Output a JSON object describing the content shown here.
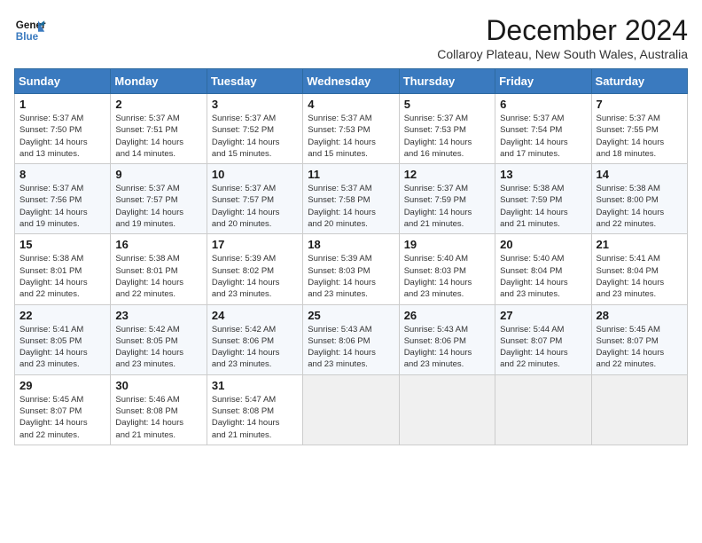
{
  "logo": {
    "line1": "General",
    "line2": "Blue"
  },
  "title": "December 2024",
  "subtitle": "Collaroy Plateau, New South Wales, Australia",
  "days_of_week": [
    "Sunday",
    "Monday",
    "Tuesday",
    "Wednesday",
    "Thursday",
    "Friday",
    "Saturday"
  ],
  "weeks": [
    [
      {
        "day": "1",
        "info": "Sunrise: 5:37 AM\nSunset: 7:50 PM\nDaylight: 14 hours\nand 13 minutes."
      },
      {
        "day": "2",
        "info": "Sunrise: 5:37 AM\nSunset: 7:51 PM\nDaylight: 14 hours\nand 14 minutes."
      },
      {
        "day": "3",
        "info": "Sunrise: 5:37 AM\nSunset: 7:52 PM\nDaylight: 14 hours\nand 15 minutes."
      },
      {
        "day": "4",
        "info": "Sunrise: 5:37 AM\nSunset: 7:53 PM\nDaylight: 14 hours\nand 15 minutes."
      },
      {
        "day": "5",
        "info": "Sunrise: 5:37 AM\nSunset: 7:53 PM\nDaylight: 14 hours\nand 16 minutes."
      },
      {
        "day": "6",
        "info": "Sunrise: 5:37 AM\nSunset: 7:54 PM\nDaylight: 14 hours\nand 17 minutes."
      },
      {
        "day": "7",
        "info": "Sunrise: 5:37 AM\nSunset: 7:55 PM\nDaylight: 14 hours\nand 18 minutes."
      }
    ],
    [
      {
        "day": "8",
        "info": "Sunrise: 5:37 AM\nSunset: 7:56 PM\nDaylight: 14 hours\nand 19 minutes."
      },
      {
        "day": "9",
        "info": "Sunrise: 5:37 AM\nSunset: 7:57 PM\nDaylight: 14 hours\nand 19 minutes."
      },
      {
        "day": "10",
        "info": "Sunrise: 5:37 AM\nSunset: 7:57 PM\nDaylight: 14 hours\nand 20 minutes."
      },
      {
        "day": "11",
        "info": "Sunrise: 5:37 AM\nSunset: 7:58 PM\nDaylight: 14 hours\nand 20 minutes."
      },
      {
        "day": "12",
        "info": "Sunrise: 5:37 AM\nSunset: 7:59 PM\nDaylight: 14 hours\nand 21 minutes."
      },
      {
        "day": "13",
        "info": "Sunrise: 5:38 AM\nSunset: 7:59 PM\nDaylight: 14 hours\nand 21 minutes."
      },
      {
        "day": "14",
        "info": "Sunrise: 5:38 AM\nSunset: 8:00 PM\nDaylight: 14 hours\nand 22 minutes."
      }
    ],
    [
      {
        "day": "15",
        "info": "Sunrise: 5:38 AM\nSunset: 8:01 PM\nDaylight: 14 hours\nand 22 minutes."
      },
      {
        "day": "16",
        "info": "Sunrise: 5:38 AM\nSunset: 8:01 PM\nDaylight: 14 hours\nand 22 minutes."
      },
      {
        "day": "17",
        "info": "Sunrise: 5:39 AM\nSunset: 8:02 PM\nDaylight: 14 hours\nand 23 minutes."
      },
      {
        "day": "18",
        "info": "Sunrise: 5:39 AM\nSunset: 8:03 PM\nDaylight: 14 hours\nand 23 minutes."
      },
      {
        "day": "19",
        "info": "Sunrise: 5:40 AM\nSunset: 8:03 PM\nDaylight: 14 hours\nand 23 minutes."
      },
      {
        "day": "20",
        "info": "Sunrise: 5:40 AM\nSunset: 8:04 PM\nDaylight: 14 hours\nand 23 minutes."
      },
      {
        "day": "21",
        "info": "Sunrise: 5:41 AM\nSunset: 8:04 PM\nDaylight: 14 hours\nand 23 minutes."
      }
    ],
    [
      {
        "day": "22",
        "info": "Sunrise: 5:41 AM\nSunset: 8:05 PM\nDaylight: 14 hours\nand 23 minutes."
      },
      {
        "day": "23",
        "info": "Sunrise: 5:42 AM\nSunset: 8:05 PM\nDaylight: 14 hours\nand 23 minutes."
      },
      {
        "day": "24",
        "info": "Sunrise: 5:42 AM\nSunset: 8:06 PM\nDaylight: 14 hours\nand 23 minutes."
      },
      {
        "day": "25",
        "info": "Sunrise: 5:43 AM\nSunset: 8:06 PM\nDaylight: 14 hours\nand 23 minutes."
      },
      {
        "day": "26",
        "info": "Sunrise: 5:43 AM\nSunset: 8:06 PM\nDaylight: 14 hours\nand 23 minutes."
      },
      {
        "day": "27",
        "info": "Sunrise: 5:44 AM\nSunset: 8:07 PM\nDaylight: 14 hours\nand 22 minutes."
      },
      {
        "day": "28",
        "info": "Sunrise: 5:45 AM\nSunset: 8:07 PM\nDaylight: 14 hours\nand 22 minutes."
      }
    ],
    [
      {
        "day": "29",
        "info": "Sunrise: 5:45 AM\nSunset: 8:07 PM\nDaylight: 14 hours\nand 22 minutes."
      },
      {
        "day": "30",
        "info": "Sunrise: 5:46 AM\nSunset: 8:08 PM\nDaylight: 14 hours\nand 21 minutes."
      },
      {
        "day": "31",
        "info": "Sunrise: 5:47 AM\nSunset: 8:08 PM\nDaylight: 14 hours\nand 21 minutes."
      },
      {
        "day": "",
        "info": ""
      },
      {
        "day": "",
        "info": ""
      },
      {
        "day": "",
        "info": ""
      },
      {
        "day": "",
        "info": ""
      }
    ]
  ]
}
